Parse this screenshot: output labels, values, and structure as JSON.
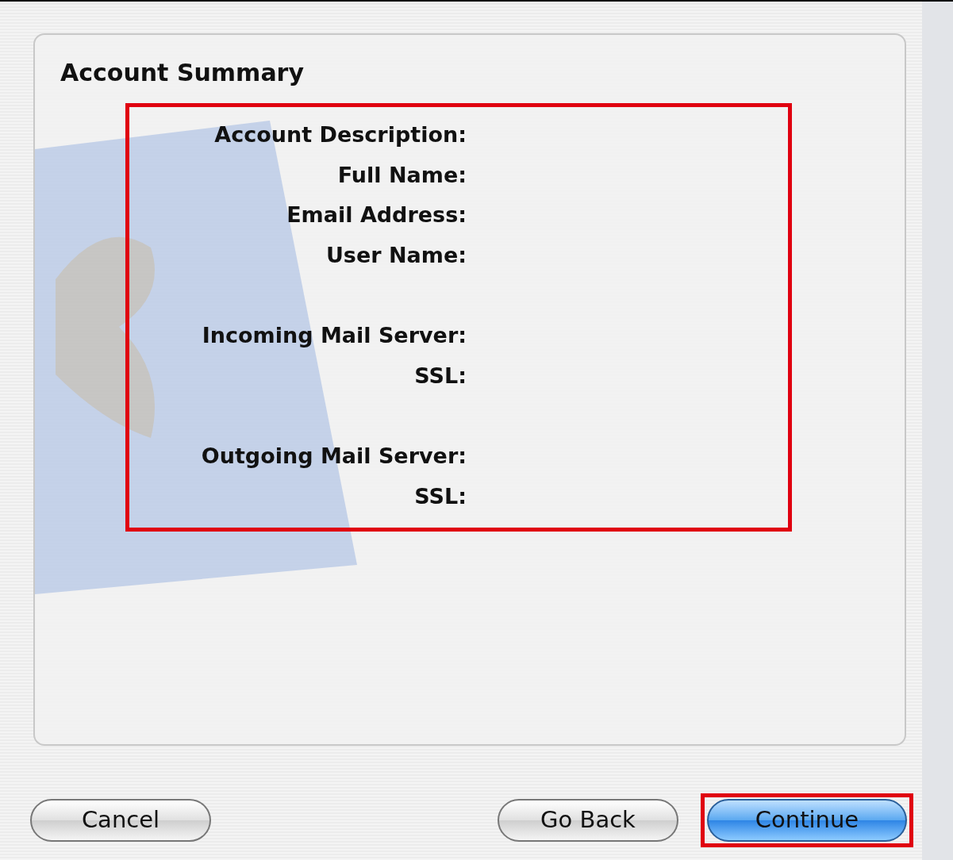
{
  "panel": {
    "title": "Account Summary"
  },
  "summary": {
    "highlighted": true,
    "groups": [
      {
        "labels": [
          "Account Description:",
          "Full Name:",
          "Email Address:",
          "User Name:"
        ]
      },
      {
        "labels": [
          "Incoming Mail Server:",
          "SSL:"
        ]
      },
      {
        "labels": [
          "Outgoing Mail Server:",
          "SSL:"
        ]
      }
    ]
  },
  "buttons": [
    {
      "label": "Cancel",
      "kind": "default",
      "highlighted": false
    },
    {
      "label": "Go Back",
      "kind": "default",
      "highlighted": false
    },
    {
      "label": "Continue",
      "kind": "primary",
      "highlighted": true
    }
  ]
}
